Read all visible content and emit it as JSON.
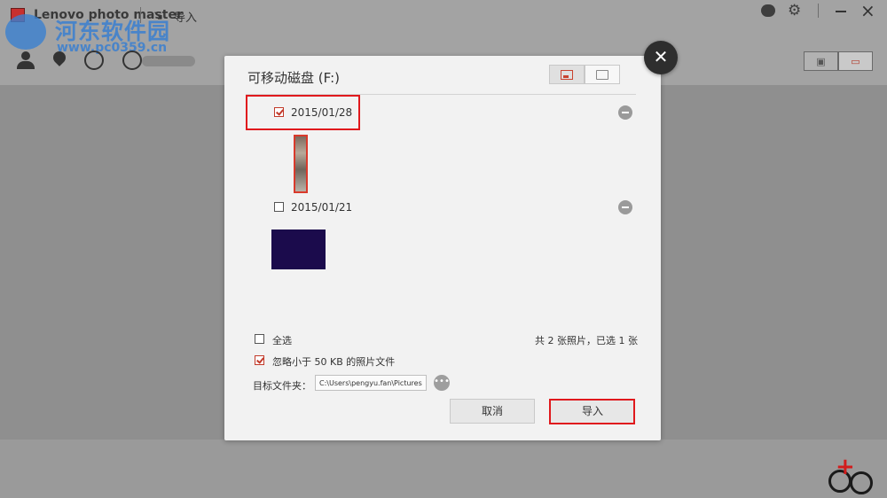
{
  "app": {
    "title": "Lenovo photo master",
    "import_label": "导入"
  },
  "watermark": {
    "text": "河东软件园",
    "url": "www.pc0359.cn"
  },
  "dialog": {
    "title": "可移动磁盘 (F:)",
    "groups": [
      {
        "date": "2015/01/28",
        "checked": true
      },
      {
        "date": "2015/01/21",
        "checked": false
      }
    ],
    "select_all_label": "全选",
    "count_text": "共 2 张照片，已选 1 张",
    "ignore_small_label": "忽略小于  50 KB 的照片文件",
    "target_label": "目标文件夹：",
    "target_path": "C:\\Users\\pengyu.fan\\Pictures",
    "browse_label": "•••",
    "cancel_label": "取消",
    "import_label": "导入",
    "close_label": "✕"
  },
  "colors": {
    "accent": "#c23a2a",
    "highlight_frame": "#e0191d",
    "overlay": "#8f8f8f"
  }
}
